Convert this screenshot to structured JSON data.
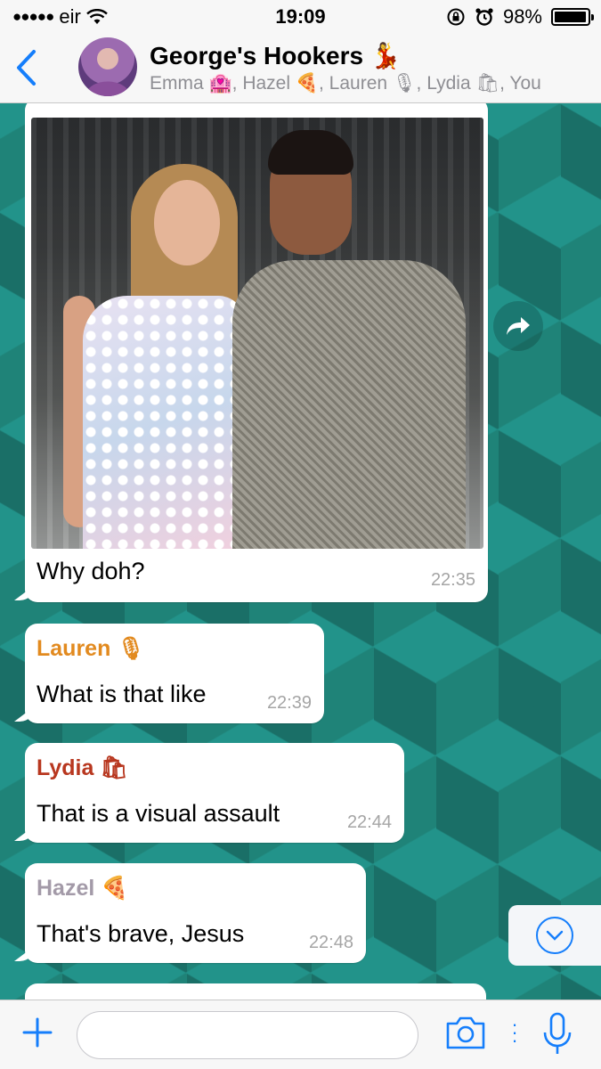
{
  "status_bar": {
    "carrier": "eir",
    "time": "19:09",
    "battery": "98%",
    "battery_level": 0.98
  },
  "header": {
    "back_icon": "chevron-left-icon",
    "title": "George's Hookers 💃",
    "members": "Emma 🏩, Hazel 🍕, Lauren 🎙, Lydia 🛍, You"
  },
  "messages": [
    {
      "type": "image",
      "caption": "Why doh?",
      "time": "22:35"
    },
    {
      "sender": "Lauren 🎙",
      "sender_color": "#e28a1f",
      "text": "What is that like",
      "time": "22:39"
    },
    {
      "sender": "Lydia 🛍",
      "sender_color": "#b8371f",
      "text": "That is a visual assault",
      "time": "22:44"
    },
    {
      "sender": "Hazel 🍕",
      "sender_color": "#a39aa8",
      "text": "That's brave, Jesus",
      "time": "22:48"
    }
  ],
  "colors": {
    "accent": "#157efb",
    "chat_background": "#1f8378"
  },
  "input": {
    "placeholder": ""
  }
}
